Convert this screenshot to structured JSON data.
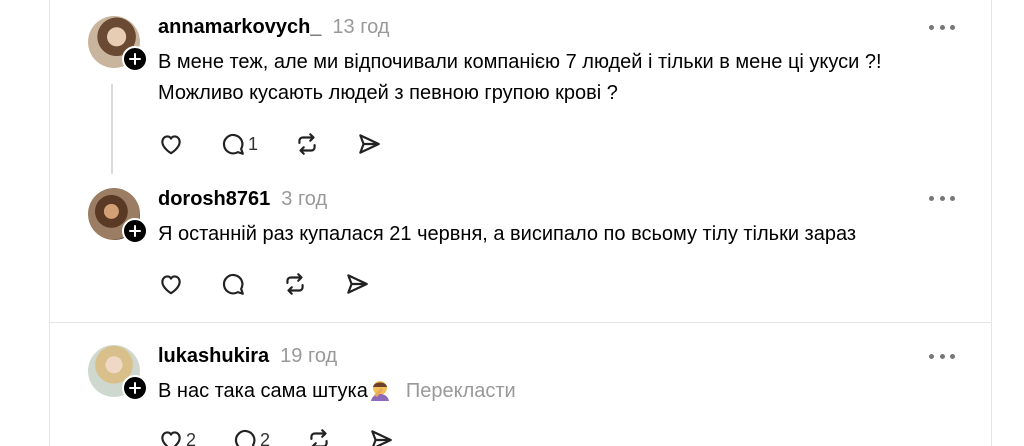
{
  "comments": [
    {
      "username": "annamarkovych_",
      "time": "13 год",
      "text_lines": [
        "В мене теж, але ми відпочивали компанією 7 людей і тільки в мене ці укуси ?!",
        "Можливо кусають людей з певною групою крові ?"
      ],
      "replies_count": "1"
    },
    {
      "username": "dorosh8761",
      "time": "3 год",
      "text": "Я останній раз купалася 21 червня, а висипало по всьому тілу тільки зараз"
    },
    {
      "username": "lukashukira",
      "time": "19 год",
      "text": "В нас така сама штука",
      "emoji": "woman-facepalming",
      "translate_label": "Перекласти",
      "likes_count": "2",
      "replies_count": "2"
    }
  ],
  "icons": {
    "like": "heart-icon",
    "reply": "comment-icon",
    "repost": "repost-icon",
    "share": "send-icon",
    "follow": "plus-icon",
    "more": "more-icon"
  }
}
